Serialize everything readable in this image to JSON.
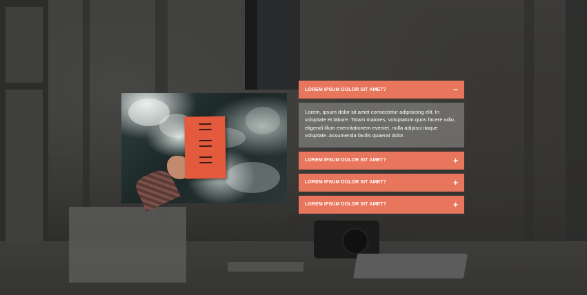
{
  "accordion": {
    "items": [
      {
        "title": "LOREM IPSUM DOLOR SIT AMET?",
        "icon": "minus-icon",
        "icon_glyph": "−",
        "expanded": true,
        "body": "Lorem, ipsum dolor sit amet consectetur adipisicing elit. In voluptate et labore. Totam maiores, voluptatum quos facere odio, eligendi illum exercitationem eveniet, nulla adipisci itaque voluptate. Assumenda facilis quaerat dolor."
      },
      {
        "title": "LOREM IPSUM DOLOR SIT AMET?",
        "icon": "plus-icon",
        "icon_glyph": "+",
        "expanded": false
      },
      {
        "title": "LOREM IPSUM DOLOR SIT AMET?",
        "icon": "plus-icon",
        "icon_glyph": "+",
        "expanded": false
      },
      {
        "title": "LOREM IPSUM DOLOR SIT AMET?",
        "icon": "plus-icon",
        "icon_glyph": "+",
        "expanded": false
      }
    ]
  },
  "colors": {
    "accent": "#e8765c",
    "body_overlay": "#969694"
  }
}
